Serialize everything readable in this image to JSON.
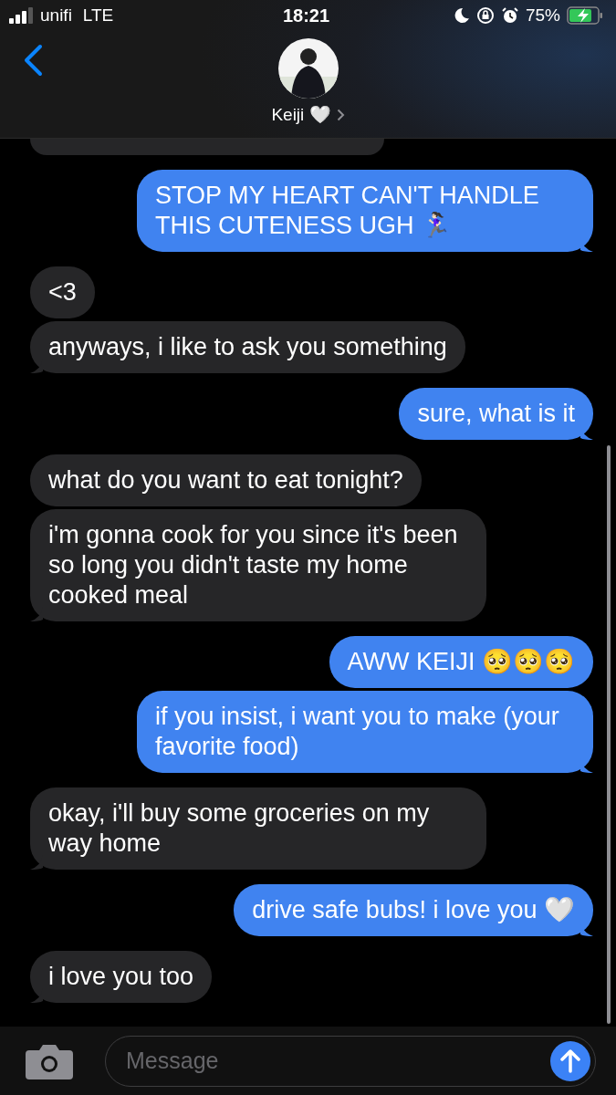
{
  "status_bar": {
    "carrier": "unifi",
    "network": "LTE",
    "time": "18:21",
    "battery": "75%"
  },
  "header": {
    "contact_name": "Keiji 🤍"
  },
  "messages": [
    {
      "kind": "me",
      "text": "STOP MY HEART CAN'T HANDLE THIS CUTENESS UGH 🏃🏻‍♀️"
    },
    {
      "kind": "them",
      "text": "<3"
    },
    {
      "kind": "them",
      "text": "anyways, i like to ask you something"
    },
    {
      "kind": "me",
      "text": "sure, what is it"
    },
    {
      "kind": "them",
      "text": "what do you want to eat tonight?"
    },
    {
      "kind": "them",
      "text": "i'm gonna cook for you since it's been so long you didn't taste my home cooked meal"
    },
    {
      "kind": "me",
      "text": "AWW KEIJI 🥺🥺🥺"
    },
    {
      "kind": "me",
      "text": "if you insist, i want you to make (your favorite food)"
    },
    {
      "kind": "them",
      "text": "okay, i'll buy some groceries on my way home"
    },
    {
      "kind": "me",
      "text": "drive safe bubs! i love you 🤍"
    },
    {
      "kind": "them",
      "text": "i love you too"
    }
  ],
  "composer": {
    "placeholder": "Message"
  }
}
